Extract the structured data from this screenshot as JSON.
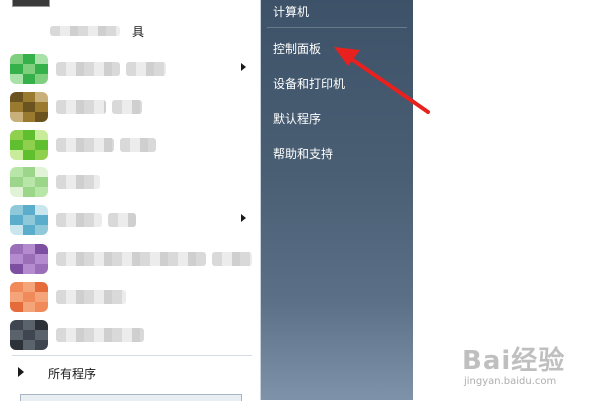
{
  "left_pane": {
    "top_item_tail": "具",
    "all_programs_label": "所有程序",
    "programs": [
      {
        "has_submenu": true,
        "icon_colors": [
          "#7fcf7f",
          "#35b04a",
          "#a8e2a8"
        ]
      },
      {
        "has_submenu": false,
        "icon_colors": [
          "#6b5320",
          "#9a7a2e",
          "#c9b07a"
        ]
      },
      {
        "has_submenu": false,
        "icon_colors": [
          "#8fd14f",
          "#5fbf2f",
          "#c8ec9a"
        ]
      },
      {
        "has_submenu": false,
        "icon_colors": [
          "#b8e6a8",
          "#9cd68a",
          "#e0f3d6"
        ]
      },
      {
        "has_submenu": true,
        "icon_colors": [
          "#8fc9d9",
          "#5aaecb",
          "#c9e6ee"
        ]
      },
      {
        "has_submenu": false,
        "icon_colors": [
          "#9a6fb8",
          "#b58bd0",
          "#7c4fa0"
        ]
      },
      {
        "has_submenu": false,
        "icon_colors": [
          "#f08a5a",
          "#f5a47a",
          "#e56c3a"
        ]
      },
      {
        "has_submenu": false,
        "icon_colors": [
          "#3f4650",
          "#5a626c",
          "#2c3238"
        ]
      }
    ]
  },
  "right_pane": {
    "items": [
      {
        "label": "计算机"
      },
      {
        "label": "控制面板"
      },
      {
        "label": "设备和打印机"
      },
      {
        "label": "默认程序"
      },
      {
        "label": "帮助和支持"
      }
    ]
  },
  "annotation": {
    "color": "#e8201e"
  },
  "watermark": {
    "brand": "Bai经验",
    "url": "jingyan.baidu.com"
  }
}
